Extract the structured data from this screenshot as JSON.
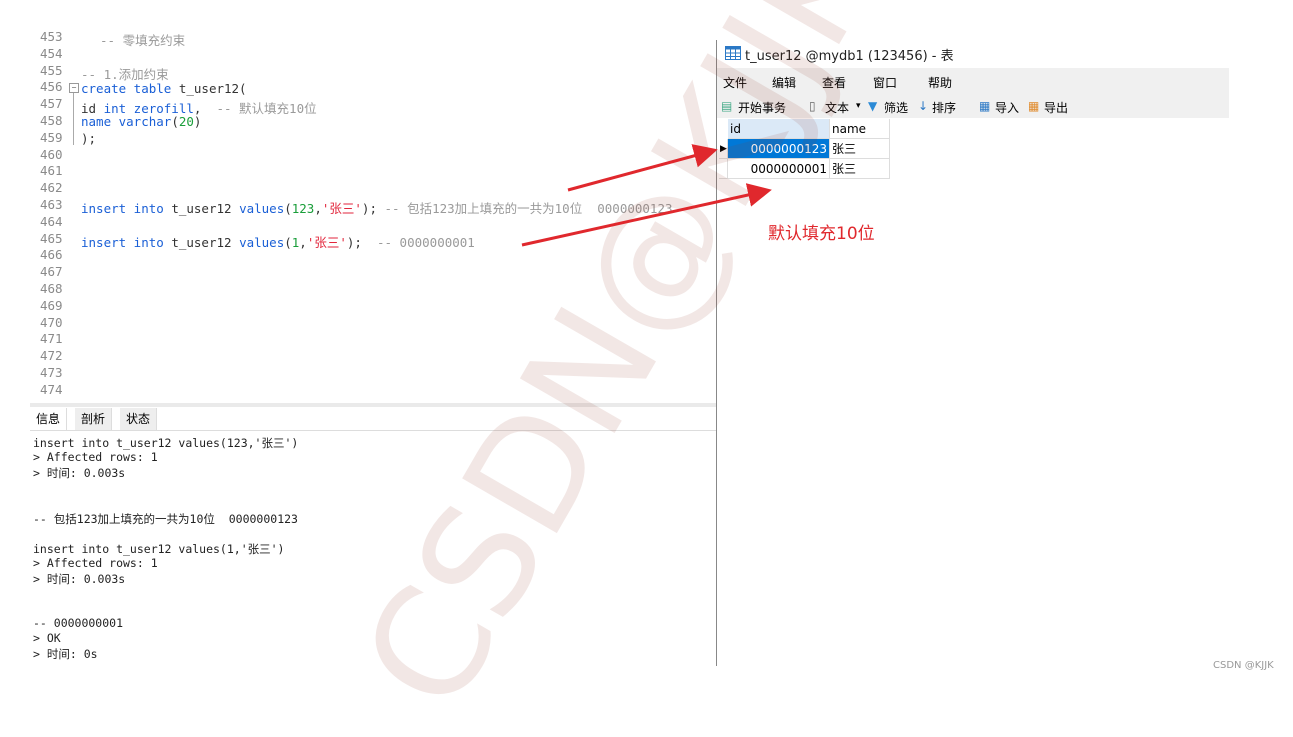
{
  "editor": {
    "line_numbers": [
      "453",
      "454",
      "455",
      "456",
      "457",
      "458",
      "459",
      "460",
      "461",
      "462",
      "463",
      "464",
      "465",
      "466",
      "467",
      "468",
      "469",
      "470",
      "471",
      "472",
      "473",
      "474"
    ],
    "partial_top_comment": "-- 零填充约束",
    "l455": "-- 1.添加约束",
    "l456": {
      "kw": "create table",
      "rest": " t_user12("
    },
    "l457": {
      "a": "id ",
      "kw": "int zerofill",
      "b": ",  ",
      "cm": "-- 默认填充10位"
    },
    "l458": {
      "kw": "name varchar",
      "a": "(",
      "num": "20",
      "b": ")"
    },
    "l459": ");",
    "l463": {
      "kw1": "insert into",
      "a": " t_user12 ",
      "kw2": "values",
      "b": "(",
      "num": "123",
      "c": ",",
      "str": "'张三'",
      "d": "); ",
      "cm": "-- 包括123加上填充的一共为10位  0000000123"
    },
    "l465": {
      "kw1": "insert into",
      "a": " t_user12 ",
      "kw2": "values",
      "b": "(",
      "num": "1",
      "c": ",",
      "str": "'张三'",
      "d": ");  ",
      "cm": "-- 0000000001"
    }
  },
  "output": {
    "tabs": [
      "信息",
      "剖析",
      "状态"
    ],
    "lines": [
      "insert into t_user12 values(123,'张三')",
      "> Affected rows: 1",
      "> 时间: 0.003s",
      "-- 包括123加上填充的一共为10位  0000000123",
      "insert into t_user12 values(1,'张三')",
      "> Affected rows: 1",
      "> 时间: 0.003s",
      "-- 0000000001",
      "> OK",
      "> 时间: 0s"
    ]
  },
  "table_window": {
    "title": "t_user12 @mydb1 (123456) - 表",
    "menu": [
      "文件",
      "编辑",
      "查看",
      "窗口",
      "帮助"
    ],
    "toolbar": {
      "begin": "开始事务",
      "text": "文本",
      "filter": "筛选",
      "sort": "排序",
      "import": "导入",
      "export": "导出"
    },
    "columns": [
      "id",
      "name"
    ],
    "rows": [
      [
        "0000000123",
        "张三"
      ],
      [
        "0000000001",
        "张三"
      ]
    ],
    "selection_color": "#0078d7"
  },
  "annotation": "默认填充10位",
  "annotation_color": "#e0282d",
  "watermark": "CSDN@KJJK",
  "credit": "CSDN @KJJK"
}
